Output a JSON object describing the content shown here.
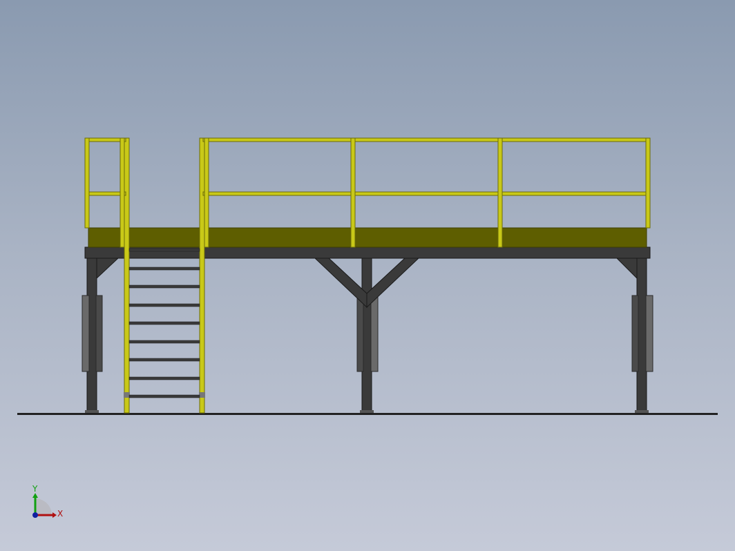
{
  "view": {
    "background_top": "#8a9ab0",
    "background_bottom": "#c5cad8"
  },
  "colors": {
    "railing": "#c9c918",
    "railing_shadow": "#8f8f10",
    "deck_plate": "#5e5e00",
    "frame_steel": "#3a3a3a",
    "frame_steel_light": "#555555",
    "base_plate": "#6a6a6a",
    "ground_line": "#222222"
  },
  "triad": {
    "x_label": "X",
    "y_label": "Y",
    "x_color": "#b01010",
    "y_color": "#10a010",
    "z_color": "#1020a0"
  },
  "model": {
    "ladder_rung_count": 9,
    "handrail_post_count": 6,
    "column_count": 3
  }
}
